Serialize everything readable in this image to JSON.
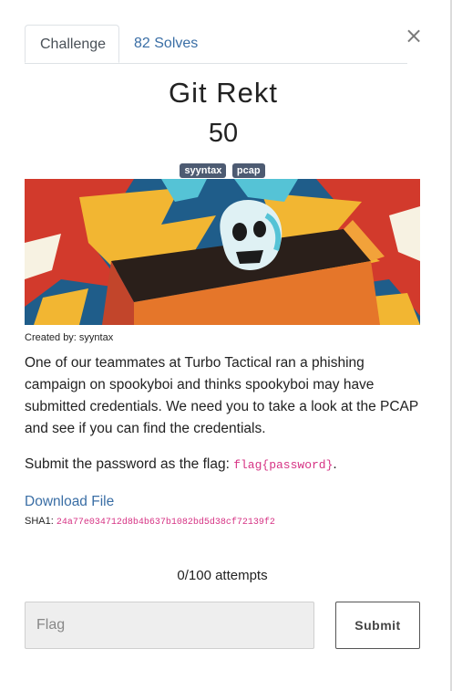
{
  "tabs": [
    {
      "label": "Challenge"
    },
    {
      "label": "82 Solves"
    }
  ],
  "close_glyph": "×",
  "challenge": {
    "name": "Git Rekt",
    "value": "50",
    "tags": [
      "syyntax",
      "pcap"
    ],
    "created_by": "Created by: syyntax",
    "description": "One of our teammates at Turbo Tactical ran a phishing campaign on spookyboi and thinks spookyboi may have submitted credentials. We need you to take a look at the PCAP and see if you can find the credentials.",
    "submit_text": "Submit the password as the flag:",
    "flag_format": "flag{password}",
    "submit_suffix": ".",
    "download_label": "Download File",
    "sha_label": "SHA1:",
    "sha_value": "24a77e034712d8b4b637b1082bd5d38cf72139f2"
  },
  "attempts": "0/100 attempts",
  "form": {
    "flag_placeholder": "Flag",
    "submit_label": "Submit"
  },
  "colors": {
    "link": "#3a6ea5",
    "tag_bg": "#4d5b72",
    "code": "#d63384",
    "input_bg": "#eeeeee"
  }
}
